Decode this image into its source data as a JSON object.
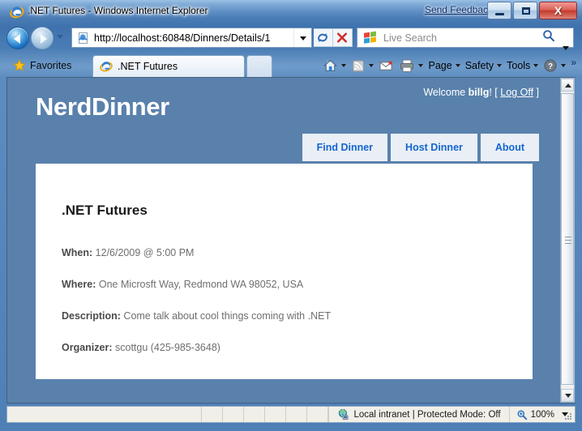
{
  "window": {
    "title": ".NET Futures - Windows Internet Explorer",
    "send_feedback": "Send Feedback",
    "minimize_label": "Minimize",
    "maximize_label": "Maximize",
    "close_label": "X"
  },
  "browser": {
    "back_label": "Back",
    "forward_label": "Forward",
    "url": "http://localhost:60848/Dinners/Details/1",
    "refresh_label": "Refresh",
    "stop_label": "Stop",
    "search_placeholder": "Live Search",
    "favorites_label": "Favorites",
    "tab_label": ".NET Futures",
    "new_tab_label": "",
    "commands": [
      {
        "label": "",
        "icon": "home-icon",
        "has_caret": true
      },
      {
        "label": "",
        "icon": "rss-feed-icon",
        "has_caret": true
      },
      {
        "label": "",
        "icon": "mail-icon",
        "has_caret": false
      },
      {
        "label": "",
        "icon": "print-icon",
        "has_caret": true
      },
      {
        "label": "Page",
        "icon": "",
        "has_caret": true
      },
      {
        "label": "Safety",
        "icon": "",
        "has_caret": true
      },
      {
        "label": "Tools",
        "icon": "",
        "has_caret": true
      },
      {
        "label": "",
        "icon": "help-icon",
        "has_caret": true
      }
    ],
    "more_chevron": "»"
  },
  "statusbar": {
    "zone_text": "Local intranet | Protected Mode: Off",
    "zoom_level": "100%"
  },
  "page": {
    "site_title": "NerdDinner",
    "welcome_prefix": "Welcome ",
    "welcome_user": "billg",
    "welcome_suffix": "! [ ",
    "logoff_label": "Log Off",
    "welcome_end": " ]",
    "nav_tabs": [
      {
        "label": "Find Dinner"
      },
      {
        "label": "Host Dinner"
      },
      {
        "label": "About"
      }
    ],
    "dinner": {
      "title": ".NET Futures",
      "when_label": "When:",
      "when_value": " 12/6/2009 @ 5:00 PM",
      "where_label": "Where:",
      "where_value": " One Microsft Way, Redmond WA 98052, USA",
      "description_label": "Description:",
      "description_value": " Come talk about cool things coming with .NET",
      "organizer_label": "Organizer:",
      "organizer_value": " scottgu (425-985-3648)"
    }
  },
  "colors": {
    "page_header_bg": "#5981ac",
    "nav_tab_bg": "#e9eff5",
    "nav_tab_text": "#1465d0",
    "content_bg": "#ffffff",
    "heading_text": "#1a1a1a",
    "field_label": "#4a4a4a",
    "field_value": "#6f6f6f"
  }
}
